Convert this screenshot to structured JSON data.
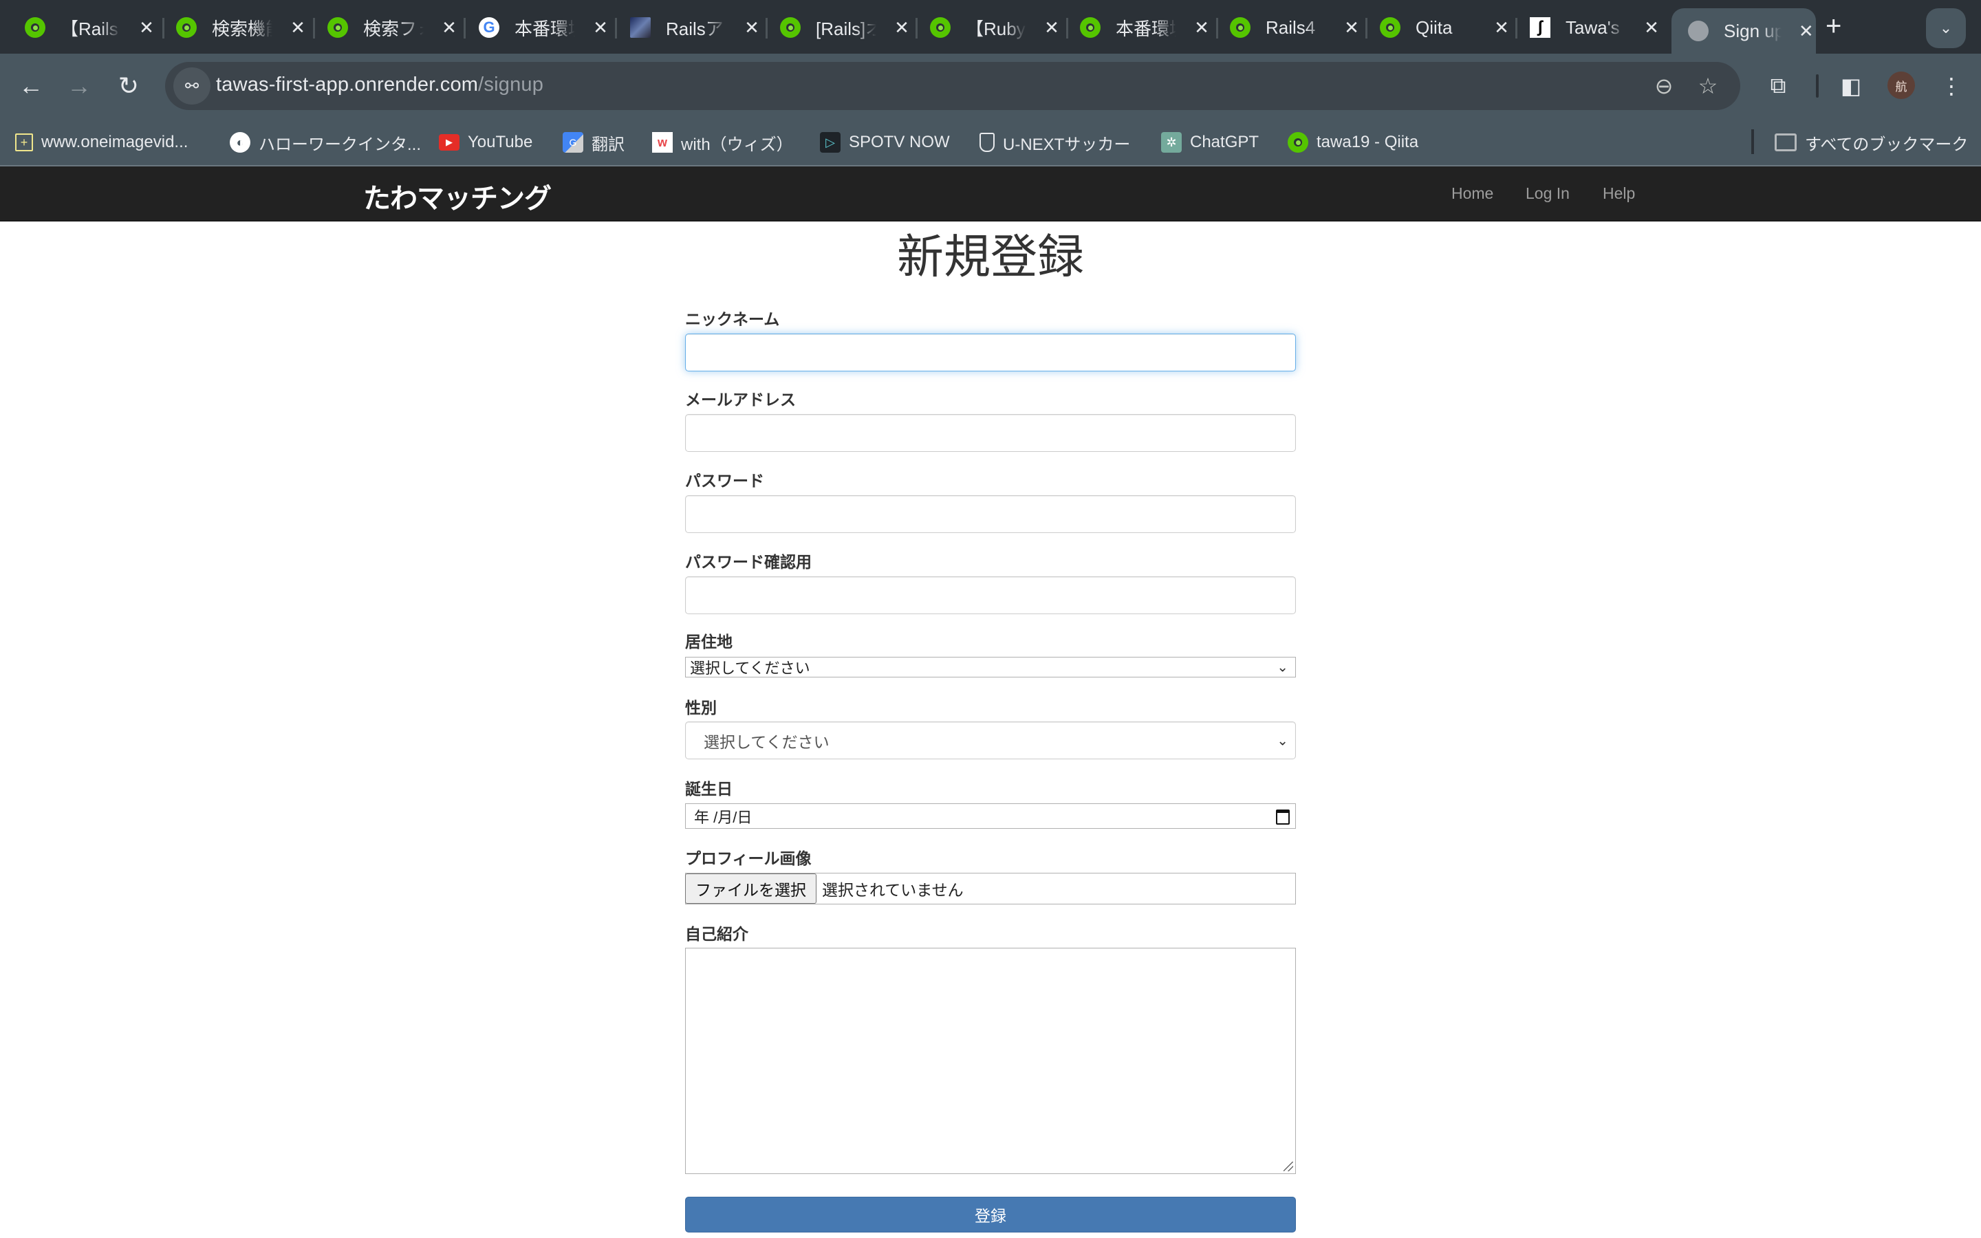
{
  "browser": {
    "tabs": [
      {
        "title": "【Rails",
        "favicon": "qiita-icon"
      },
      {
        "title": "検索機能",
        "favicon": "qiita-icon"
      },
      {
        "title": "検索フォ",
        "favicon": "qiita-icon"
      },
      {
        "title": "本番環境",
        "favicon": "google-icon"
      },
      {
        "title": "Railsア",
        "favicon": "image-icon"
      },
      {
        "title": "[Rails]オ",
        "favicon": "qiita-icon"
      },
      {
        "title": "【Ruby",
        "favicon": "qiita-icon"
      },
      {
        "title": "本番環境",
        "favicon": "qiita-icon"
      },
      {
        "title": "Rails4",
        "favicon": "qiita-icon"
      },
      {
        "title": "Qiita",
        "favicon": "qiita-icon"
      },
      {
        "title": "Tawa's",
        "favicon": "tawa-icon"
      },
      {
        "title": "Sign up",
        "favicon": "globe-icon",
        "active": true
      }
    ],
    "close_glyph": "✕",
    "new_tab_glyph": "+",
    "tab_search_glyph": "⌄",
    "url_host": "tawas-first-app.onrender.com",
    "url_path": "/signup",
    "profile_initial": "航",
    "bookmarks": [
      {
        "label": "www.oneimagevid...",
        "icon": "image-plus-icon"
      },
      {
        "label": "ハローワークインタ...",
        "icon": "globe-icon"
      },
      {
        "label": "YouTube",
        "icon": "youtube-icon"
      },
      {
        "label": "翻訳",
        "icon": "google-translate-icon"
      },
      {
        "label": "with（ウィズ）",
        "icon": "with-icon"
      },
      {
        "label": "SPOTV NOW",
        "icon": "spotv-icon"
      },
      {
        "label": "U-NEXTサッカー",
        "icon": "unext-icon"
      },
      {
        "label": "ChatGPT",
        "icon": "chatgpt-icon"
      },
      {
        "label": "tawa19 - Qiita",
        "icon": "qiita-icon"
      }
    ],
    "all_bookmarks_label": "すべてのブックマーク"
  },
  "app": {
    "brand": "たわマッチング",
    "nav": [
      {
        "label": "Home"
      },
      {
        "label": "Log In"
      },
      {
        "label": "Help"
      }
    ],
    "page_title": "新規登録",
    "form": {
      "nickname_label": "ニックネーム",
      "nickname_value": "",
      "email_label": "メールアドレス",
      "email_value": "",
      "password_label": "パスワード",
      "password_value": "",
      "password_confirmation_label": "パスワード確認用",
      "password_confirmation_value": "",
      "residence_label": "居住地",
      "residence_selected": "選択してください",
      "gender_label": "性別",
      "gender_selected": "選択してください",
      "birthday_label": "誕生日",
      "birthday_placeholder": "年 /月/日",
      "profile_image_label": "プロフィール画像",
      "file_button_label": "ファイルを選択",
      "file_status": "選択されていません",
      "introduction_label": "自己紹介",
      "introduction_value": "",
      "submit_label": "登録"
    }
  }
}
